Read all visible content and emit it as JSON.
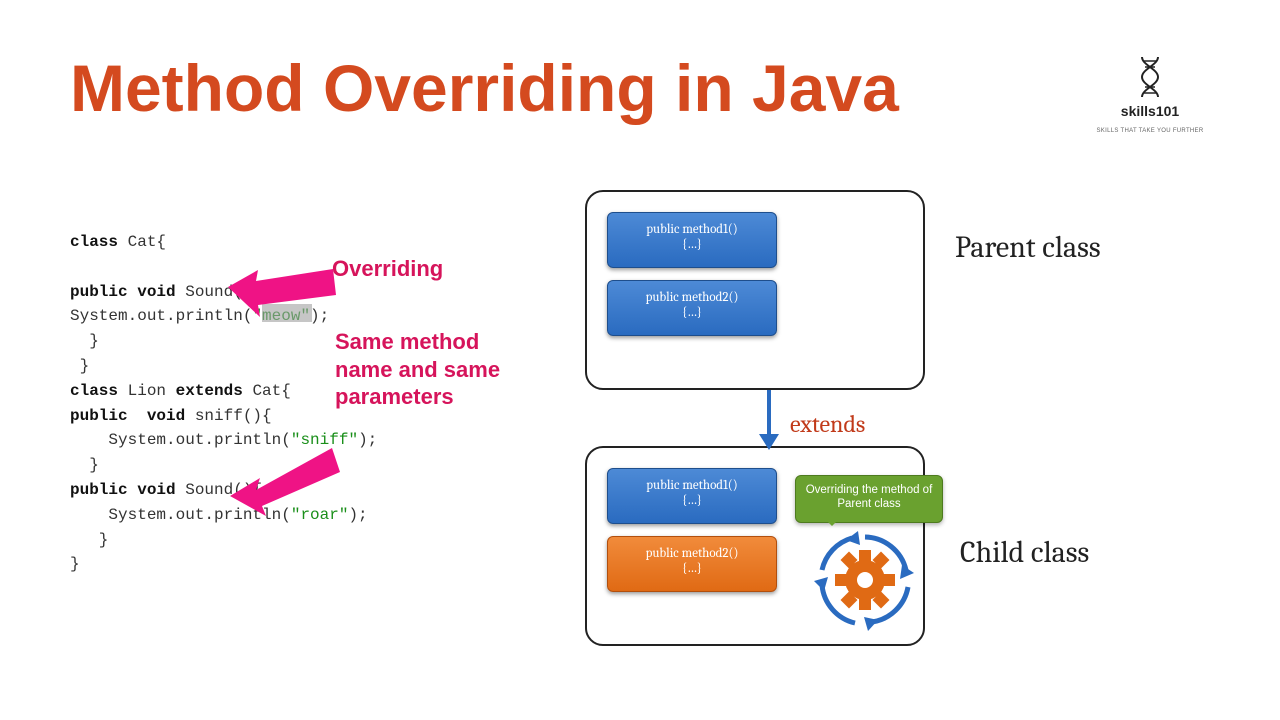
{
  "title": "Method Overriding in Java",
  "logo": {
    "brand": "skills101",
    "tagline": "SKILLS THAT TAKE YOU FURTHER"
  },
  "code": {
    "lines": [
      {
        "pre": "",
        "kw": "class",
        "mid": " Cat{",
        "after": ""
      },
      {
        "pre": "",
        "text": ""
      },
      {
        "pre": "",
        "kw": "public void",
        "mid": " Sound(){",
        "after": ""
      },
      {
        "pre": "System.out.println(",
        "str": "\"meow\"",
        "after": ");",
        "hl": true
      },
      {
        "pre": "  }",
        "text": ""
      },
      {
        "pre": " }",
        "text": ""
      },
      {
        "pre": "",
        "kw": "class",
        "mid": " Lion ",
        "kw2": "extends",
        "after": " Cat{"
      },
      {
        "pre": "",
        "kw": "public  void",
        "mid": " sniff(){",
        "after": ""
      },
      {
        "pre": "    System.out.println(",
        "str": "\"sniff\"",
        "after": ");"
      },
      {
        "pre": "  }",
        "text": ""
      },
      {
        "pre": "",
        "kw": "public void",
        "mid": " Sound(){",
        "after": ""
      },
      {
        "pre": "    System.out.println(",
        "str": "\"roar\"",
        "after": ");"
      },
      {
        "pre": "   }",
        "text": ""
      },
      {
        "pre": "}",
        "text": ""
      }
    ]
  },
  "annotation": {
    "label1": "Overriding",
    "label2": "Same method name and same parameters"
  },
  "diagram": {
    "parent": {
      "label": "Parent class",
      "methods": [
        {
          "sig": "public method1()",
          "body": "{…}",
          "color": "blue"
        },
        {
          "sig": "public method2()",
          "body": "{…}",
          "color": "blue"
        }
      ]
    },
    "extends_label": "extends",
    "child": {
      "label": "Child class",
      "methods": [
        {
          "sig": "public method1()",
          "body": "{…}",
          "color": "blue"
        },
        {
          "sig": "public method2()",
          "body": "{…}",
          "color": "orange"
        }
      ],
      "callout": "Overriding the method of Parent class"
    }
  },
  "colors": {
    "title": "#d44a1f",
    "annotation": "#d6145b",
    "extends": "#c13a1a",
    "card_blue": "#2a6bc0",
    "card_orange": "#e06a14",
    "callout_green": "#6aa12f"
  }
}
